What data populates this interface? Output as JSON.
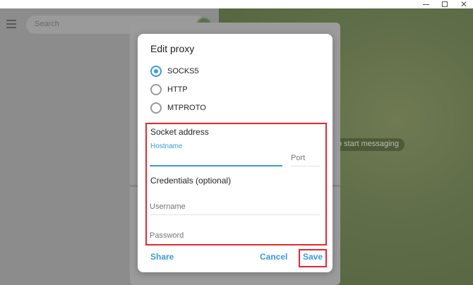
{
  "window": {
    "minimize": "—",
    "maximize": "☐",
    "close": "✕"
  },
  "sidebar": {
    "search_placeholder": "Search"
  },
  "chat": {
    "empty_hint": "o start messaging"
  },
  "dialog": {
    "title": "Edit proxy",
    "proxy_types": [
      {
        "label": "SOCKS5",
        "selected": true
      },
      {
        "label": "HTTP",
        "selected": false
      },
      {
        "label": "MTPROTO",
        "selected": false
      }
    ],
    "socket_section_title": "Socket address",
    "hostname_label": "Hostname",
    "hostname_value": "",
    "port_placeholder": "Port",
    "credentials_section_title": "Credentials (optional)",
    "username_placeholder": "Username",
    "password_placeholder": "Password",
    "share_label": "Share",
    "cancel_label": "Cancel",
    "save_label": "Save"
  },
  "colors": {
    "accent": "#3a9bdc",
    "highlight": "#e5262e"
  }
}
